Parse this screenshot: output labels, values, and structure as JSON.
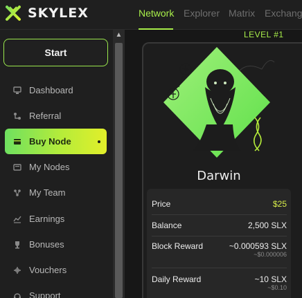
{
  "brand": {
    "name": "SKYLEX",
    "accent": "#a8ee4a"
  },
  "sidebar": {
    "start_label": "Start",
    "items": [
      {
        "label": "Dashboard",
        "icon": "monitor-icon"
      },
      {
        "label": "Referral",
        "icon": "referral-icon"
      },
      {
        "label": "Buy Node",
        "icon": "wallet-icon",
        "active": true
      },
      {
        "label": "My Nodes",
        "icon": "nodes-icon"
      },
      {
        "label": "My Team",
        "icon": "team-icon"
      },
      {
        "label": "Earnings",
        "icon": "chart-icon"
      },
      {
        "label": "Bonuses",
        "icon": "trophy-icon"
      },
      {
        "label": "Vouchers",
        "icon": "voucher-icon"
      },
      {
        "label": "Support",
        "icon": "support-icon"
      }
    ]
  },
  "tabs": [
    {
      "label": "Network",
      "active": true
    },
    {
      "label": "Explorer"
    },
    {
      "label": "Matrix"
    },
    {
      "label": "Exchange"
    }
  ],
  "node_card": {
    "level": "LEVEL #1",
    "name": "Darwin",
    "price_label": "Price",
    "price_value": "$25",
    "balance_label": "Balance",
    "balance_value": "2,500 SLX",
    "block_reward_label": "Block Reward",
    "block_reward_value": "~0.000593 SLX",
    "block_reward_usd": "~$0.000006",
    "daily_reward_label": "Daily Reward",
    "daily_reward_value": "~10 SLX",
    "daily_reward_usd": "~$0.10"
  }
}
